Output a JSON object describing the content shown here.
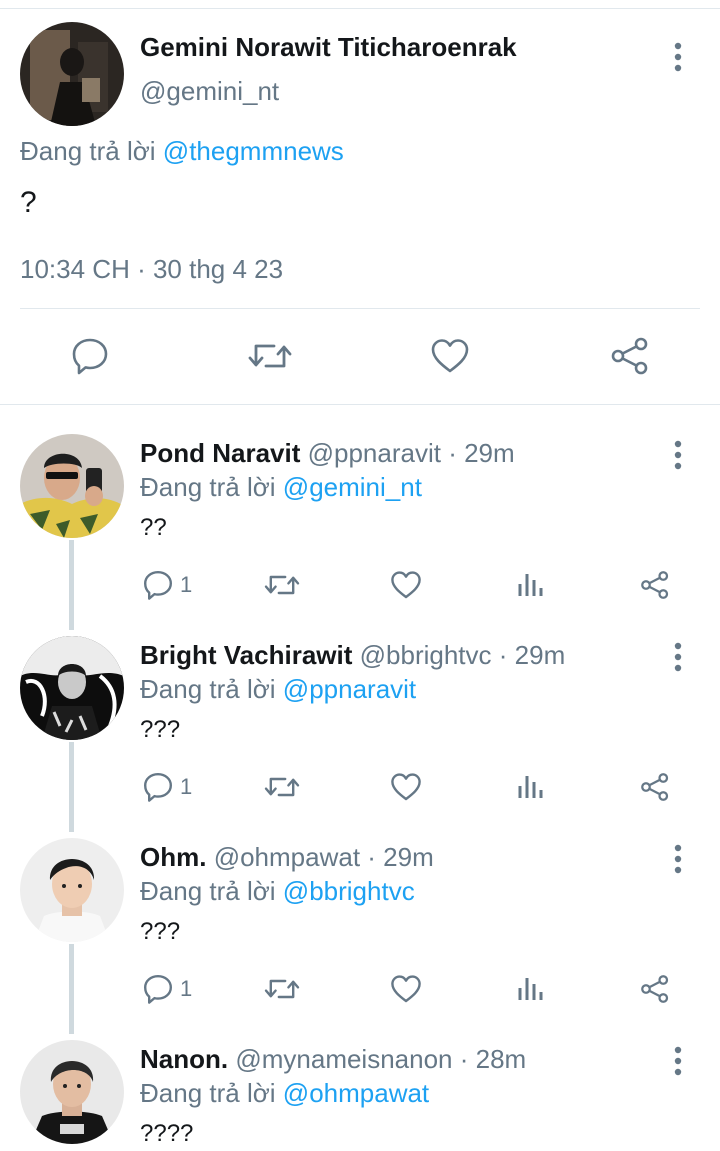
{
  "main_tweet": {
    "name": "Gemini Norawit Titicharoenrak",
    "handle": "@gemini_nt",
    "replying_prefix": "Đang trả lời",
    "replying_to": "@thegmmnews",
    "text": "?",
    "timestamp": "10:34 CH · 30 thg 4 23",
    "actions": [
      "reply-icon",
      "retweet-icon",
      "like-icon",
      "share-icon"
    ]
  },
  "replies": [
    {
      "name": "Pond Naravit",
      "handle": "@ppnaravit",
      "time": "· 29m",
      "replying_prefix": "Đang trả lời",
      "replying_to": "@gemini_nt",
      "text": "??",
      "reply_count": "1"
    },
    {
      "name": "Bright Vachirawit",
      "handle": "@bbrightvc",
      "time": "· 29m",
      "replying_prefix": "Đang trả lời",
      "replying_to": "@ppnaravit",
      "text": "???",
      "reply_count": "1"
    },
    {
      "name": "Ohm.",
      "handle": "@ohmpawat",
      "time": "· 29m",
      "replying_prefix": "Đang trả lời",
      "replying_to": "@bbrightvc",
      "text": "???",
      "reply_count": "1"
    },
    {
      "name": "Nanon.",
      "handle": "@mynameisnanon",
      "time": "· 28m",
      "replying_prefix": "Đang trả lời",
      "replying_to": "@ohmpawat",
      "text": "????"
    }
  ],
  "colors": {
    "accent": "#1da1f2",
    "secondary_text": "#657786",
    "icon": "#657786",
    "divider": "#e1e8ed"
  }
}
